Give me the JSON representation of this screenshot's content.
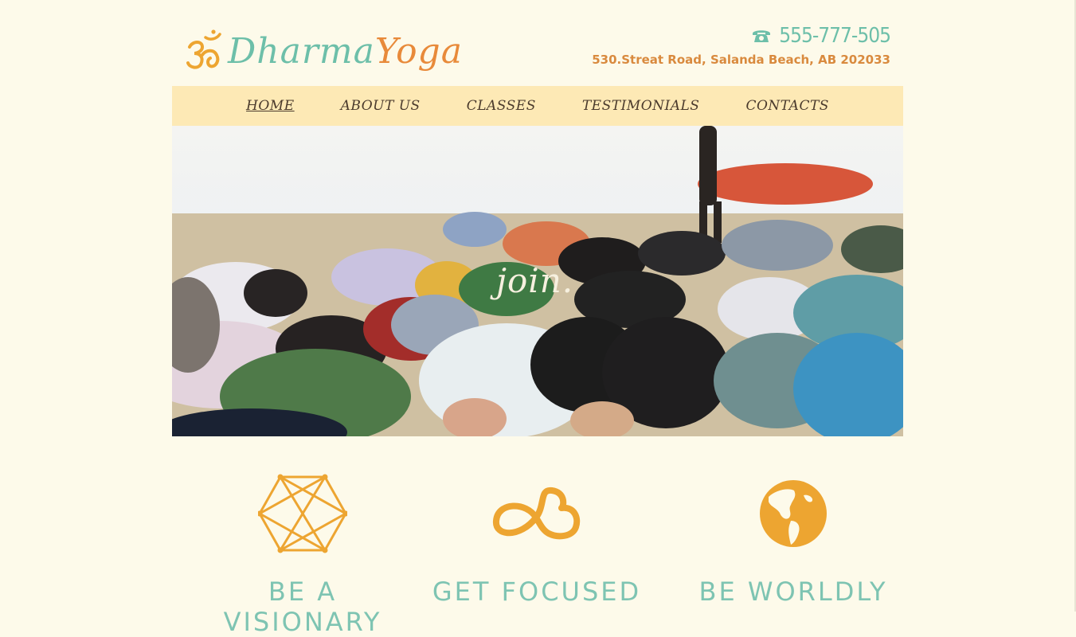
{
  "brand": {
    "name_part1": "Dharma",
    "name_part2": "Yoga"
  },
  "contact": {
    "phone": "555-777-505",
    "address": "530.Streat Road, Salanda Beach, AB 202033"
  },
  "nav": [
    {
      "label": "HOME",
      "active": true
    },
    {
      "label": "ABOUT US"
    },
    {
      "label": "CLASSES"
    },
    {
      "label": "TESTIMONIALS"
    },
    {
      "label": "CONTACTS"
    }
  ],
  "hero": {
    "word": "join."
  },
  "features": [
    {
      "icon": "geometric-hexagon-icon",
      "title": "BE A VISIONARY"
    },
    {
      "icon": "cloud-infinity-icon",
      "title": "GET FOCUSED"
    },
    {
      "icon": "globe-icon",
      "title": "BE WORLDLY"
    }
  ],
  "colors": {
    "background": "#fdfaea",
    "nav": "#fde9b5",
    "teal": "#6dbfa9",
    "orange": "#e88a3a",
    "gold": "#eda531"
  }
}
